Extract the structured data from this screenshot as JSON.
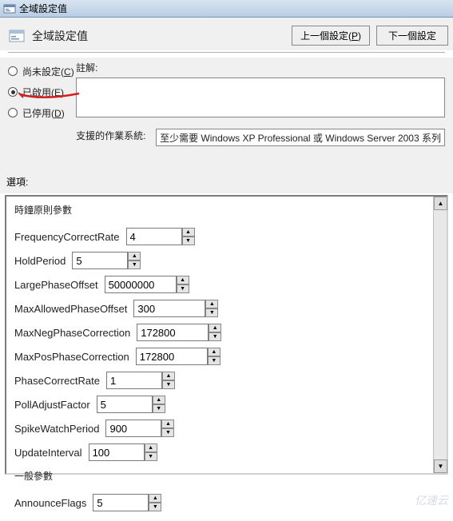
{
  "window": {
    "title": "全域設定值"
  },
  "header": {
    "title": "全域設定值",
    "prev_btn": "上一個設定",
    "prev_key": "P",
    "next_btn": "下一個設定"
  },
  "state": {
    "not_configured": "尚未設定",
    "not_configured_key": "C",
    "enabled": "已啟用",
    "enabled_key": "E",
    "disabled": "已停用",
    "disabled_key": "D",
    "selected": "enabled"
  },
  "comment": {
    "label": "註解:",
    "value": ""
  },
  "supported_os": {
    "label": "支援的作業系統:",
    "value": "至少需要 Windows XP Professional 或 Windows Server 2003 系列"
  },
  "options": {
    "heading": "選項:",
    "section1_title": "時鐘原則參數",
    "section2_title": "一般參數",
    "params": [
      {
        "label": "FrequencyCorrectRate",
        "value": "4",
        "w": 70
      },
      {
        "label": "HoldPeriod",
        "value": "5",
        "w": 70
      },
      {
        "label": "LargePhaseOffset",
        "value": "50000000",
        "w": 90
      },
      {
        "label": "MaxAllowedPhaseOffset",
        "value": "300",
        "w": 90
      },
      {
        "label": "MaxNegPhaseCorrection",
        "value": "172800",
        "w": 90
      },
      {
        "label": "MaxPosPhaseCorrection",
        "value": "172800",
        "w": 90
      },
      {
        "label": "PhaseCorrectRate",
        "value": "1",
        "w": 70
      },
      {
        "label": "PollAdjustFactor",
        "value": "5",
        "w": 70
      },
      {
        "label": "SpikeWatchPeriod",
        "value": "900",
        "w": 70
      },
      {
        "label": "UpdateInterval",
        "value": "100",
        "w": 70
      }
    ],
    "params2": [
      {
        "label": "AnnounceFlags",
        "value": "5",
        "w": 70
      }
    ]
  },
  "watermark": "亿速云"
}
